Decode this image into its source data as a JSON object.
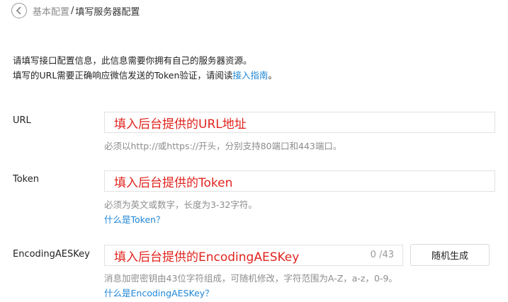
{
  "breadcrumb": {
    "parent": "基本配置",
    "separator": "/",
    "current": "填写服务器配置"
  },
  "intro": {
    "line1": "请填写接口配置信息，此信息需要你拥有自己的服务器资源。",
    "line2_prefix": "填写的URL需要正确响应微信发送的Token验证，请阅读",
    "line2_link": "接入指南",
    "line2_suffix": "。"
  },
  "form": {
    "url": {
      "label": "URL",
      "value": "填入后台提供的URL地址",
      "hint": "必须以http://或https://开头，分别支持80端口和443端口。"
    },
    "token": {
      "label": "Token",
      "value": "填入后台提供的Token",
      "hint": "必须为英文或数字，长度为3-32字符。",
      "help_link": "什么是Token？"
    },
    "aes": {
      "label": "EncodingAESKey",
      "value": "填入后台提供的EncodingAESKey",
      "counter": "0 /43",
      "generate_button": "随机生成",
      "hint": "消息加密密钥由43位字符组成，可随机修改，字符范围为A-Z，a-z，0-9。",
      "help_link": "什么是EncodingAESKey？"
    }
  },
  "colors": {
    "link": "#1f86d6",
    "value_text": "#e0241e",
    "hint_text": "#8d8d8d",
    "border": "#e2e2e2"
  },
  "icons": {
    "back": "chevron-left-circle-icon"
  }
}
